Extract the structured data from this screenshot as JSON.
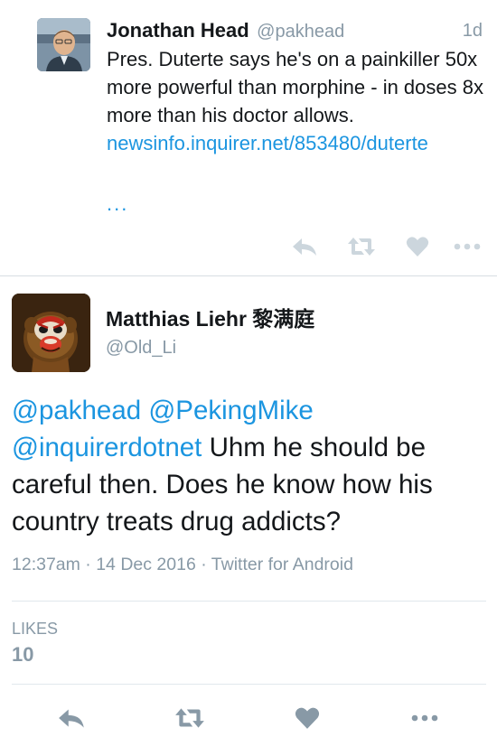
{
  "parent_tweet": {
    "name": "Jonathan Head",
    "handle": "@pakhead",
    "time": "1d",
    "text": "Pres. Duterte says he's on a painkiller 50x more powerful than morphine - in doses 8x more than his doctor allows.",
    "link": "newsinfo.inquirer.net/853480/duterte",
    "ellipsis": "...",
    "actions": [
      "reply-icon",
      "retweet-icon",
      "like-icon",
      "more-icon"
    ]
  },
  "tweet": {
    "name": "Matthias Liehr 黎满庭",
    "handle": "@Old_Li",
    "mentions": [
      "@pakhead",
      "@PekingMike",
      "@inquirerdotnet"
    ],
    "text": "Uhm he should be careful then. Does he know how his country treats drug addicts?",
    "meta": "12:37am · 14 Dec 2016 · Twitter for Android",
    "likes_label": "LIKES",
    "likes_count": "10",
    "actions": [
      "reply-icon",
      "retweet-icon",
      "like-icon",
      "more-icon"
    ]
  },
  "colors": {
    "link": "#1b95e0",
    "muted": "#8899a6",
    "text": "#14171a",
    "icon_light": "#ccd6dd",
    "icon_dark": "#8899a6"
  }
}
